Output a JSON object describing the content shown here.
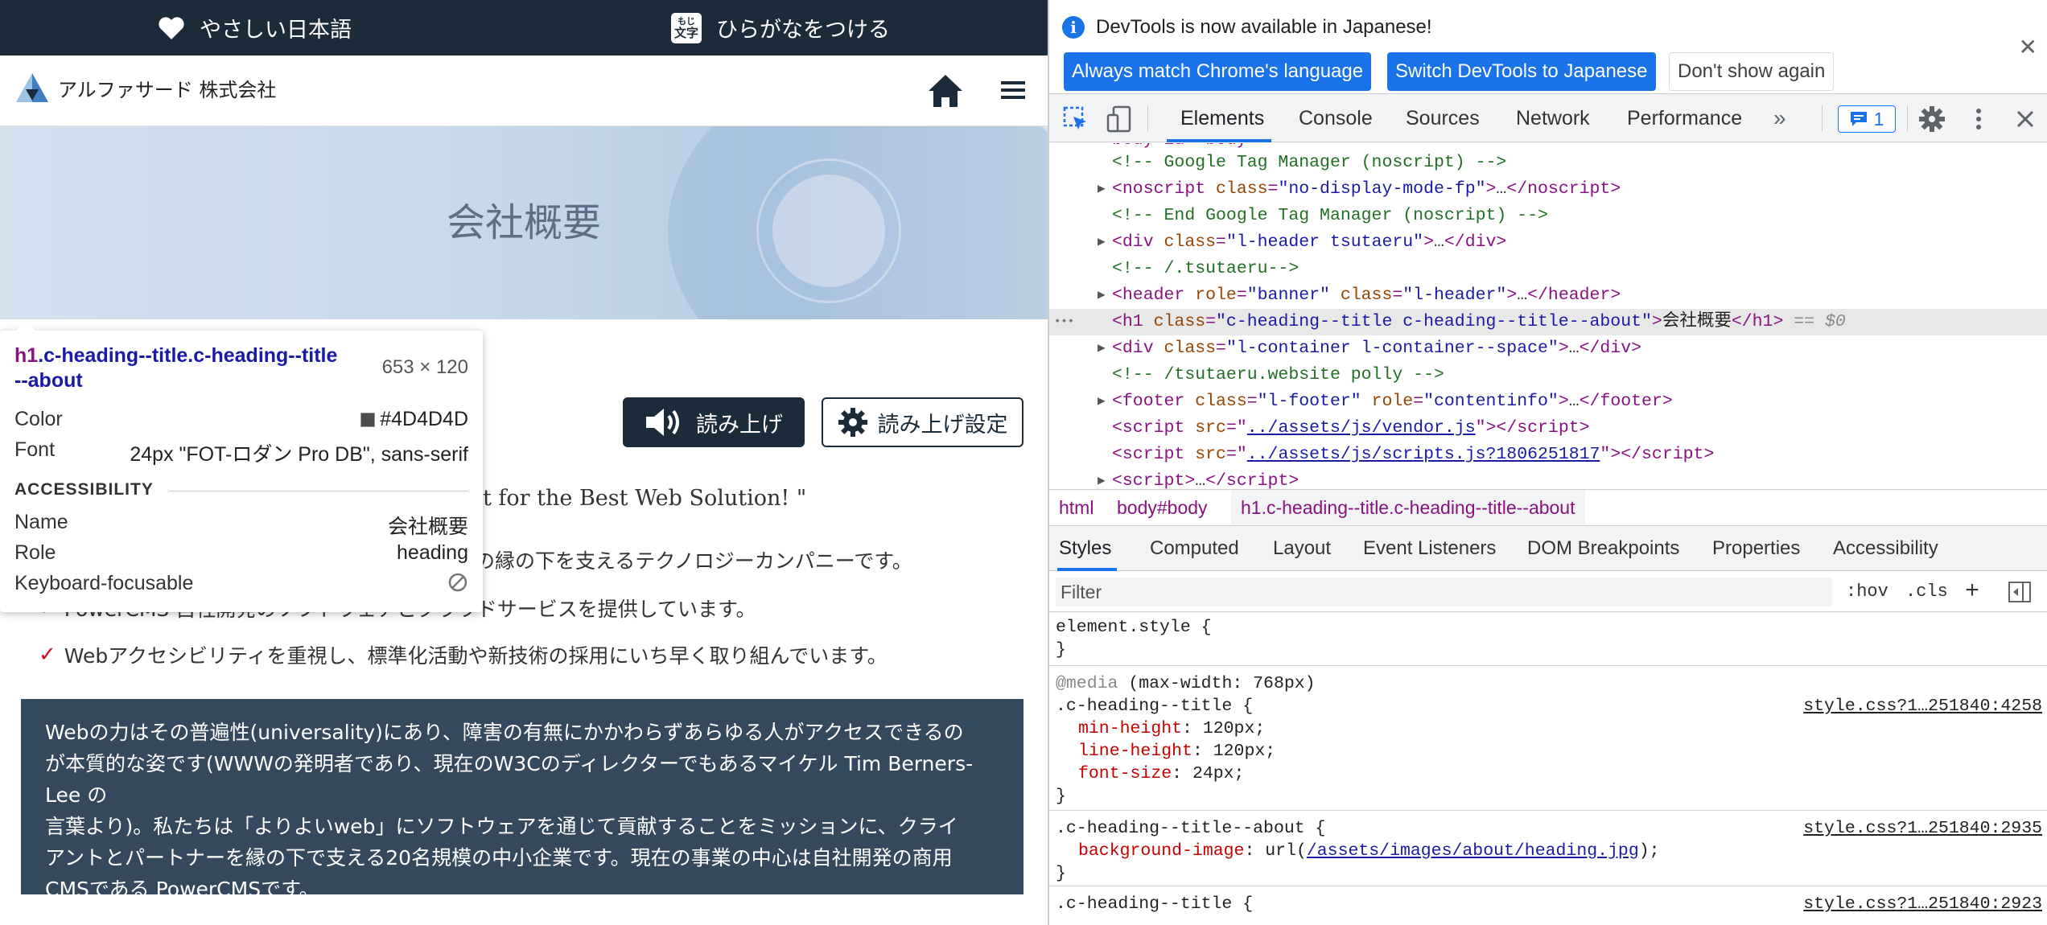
{
  "page": {
    "topbar": {
      "easy_japanese": "やさしい日本語",
      "furigana": "ひらがなをつける",
      "furigana_icon_top": "もじ",
      "furigana_icon_bottom": "文字"
    },
    "header": {
      "logo_text": "アルファサード 株式会社"
    },
    "hero": {
      "title": "会社概要"
    },
    "read_button": "読み上げ",
    "read_settings_button": "読み上げ設定",
    "tagline": "t for the Best Web Solution! \"",
    "bullets": [
      "の縁の下を支えるテクノロジーカンパニーです。",
      "PowerCMS 自社開発のソフトウェアとクラウドサービスを提供しています。",
      "Webアクセシビリティを重視し、標準化活動や新技術の採用にいち早く取り組んでいます。"
    ],
    "about_lines": [
      "Webの力はその普遍性(universality)にあり、障害の有無にかかわらずあらゆる人がアクセスできるの",
      "が本質的な姿です(WWWの発明者であり、現在のW3Cのディレクターでもあるマイケル Tim Berners-Lee の",
      "言葉より)。私たちは「よりよいweb」にソフトウェアを通じて貢献することをミッションに、クライ",
      "アントとパートナーを縁の下で支える20名規模の中小企業です。現在の事業の中心は自社開発の商用",
      "CMSである PowerCMSです。"
    ]
  },
  "tooltip": {
    "selector_tag": "h1",
    "selector_line1": ".c-heading--title.c-heading--title",
    "selector_line2": "--about",
    "dims": "653 × 120",
    "color_label": "Color",
    "color_value": "#4D4D4D",
    "font_label": "Font",
    "font_value": "24px \"FOT-ロダン Pro DB\", sans-serif",
    "accessibility_heading": "ACCESSIBILITY",
    "name_label": "Name",
    "name_value": "会社概要",
    "role_label": "Role",
    "role_value": "heading",
    "focusable_label": "Keyboard-focusable"
  },
  "devtools": {
    "infobar": {
      "message": "DevTools is now available in Japanese!",
      "btn_match": "Always match Chrome's language",
      "btn_switch": "Switch DevTools to Japanese",
      "btn_dismiss": "Don't show again"
    },
    "tabs": [
      "Elements",
      "Console",
      "Sources",
      "Network",
      "Performance"
    ],
    "more_tabs": "»",
    "issues_count": "1",
    "dom": {
      "line0": "body id=\"body\"",
      "l1": "<!-- Google Tag Manager (noscript) -->",
      "l3": "<!-- End Google Tag Manager (noscript) -->",
      "l5": "<!-- /.tsutaeru-->",
      "l9": "<!-- /tsutaeru.website polly -->",
      "noscript_class": "\"no-display-mode-fp\"",
      "div_header_class": "\"l-header tsutaeru\"",
      "header_role": "\"banner\"",
      "header_class": "\"l-header\"",
      "h1_class": "\"c-heading--title c-heading--title--about\"",
      "h1_text": "会社概要",
      "h1_eq": "== $0",
      "container_class": "\"l-container l-container--space\"",
      "footer_class": "\"l-footer\"",
      "footer_role": "\"contentinfo\"",
      "script1_src": "../assets/js/vendor.js",
      "script2_src": "../assets/js/scripts.js?1806251817",
      "ellipsis": "…",
      "dots": "•••"
    },
    "breadcrumbs": [
      "html",
      "body#body",
      "h1.c-heading--title.c-heading--title--about"
    ],
    "subtabs": [
      "Styles",
      "Computed",
      "Layout",
      "Event Listeners",
      "DOM Breakpoints",
      "Properties",
      "Accessibility"
    ],
    "filter_placeholder": "Filter",
    "hov": ":hov",
    "cls": ".cls",
    "styles": {
      "element_style": "element.style {",
      "close": "}",
      "media": "(max-width: 768px)",
      "media_kw": "@media",
      "sel1": ".c-heading--title {",
      "src1": "style.css?1…251840:4258",
      "p1_name": "min-height",
      "p1_val": "120px;",
      "p2_name": "line-height",
      "p2_val": "120px;",
      "p3_name": "font-size",
      "p3_val": "24px;",
      "sel2": ".c-heading--title--about {",
      "src2": "style.css?1…251840:2935",
      "p4_name": "background-image",
      "p4_url": "/assets/images/about/heading.jpg",
      "sel3": ".c-heading--title {",
      "src3": "style.css?1…251840:2923"
    }
  },
  "colors": {
    "navy": "#1c2b3a",
    "about_bg": "#34495e",
    "devtools_blue": "#1a73e8",
    "tag_purple": "#881280",
    "check_red": "#c8102e"
  }
}
